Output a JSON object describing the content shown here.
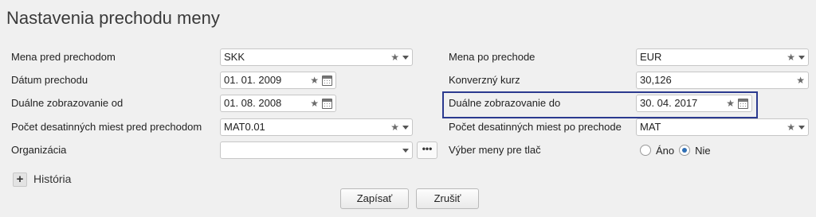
{
  "page": {
    "title": "Nastavenia prechodu meny"
  },
  "left": {
    "currency_before": {
      "label": "Mena pred prechodom",
      "value": "SKK"
    },
    "transition_date": {
      "label": "Dátum prechodu",
      "value": "01. 01. 2009"
    },
    "dual_display_from": {
      "label": "Duálne zobrazovanie od",
      "value": "01. 08. 2008"
    },
    "decimals_before": {
      "label": "Počet desatinných miest pred prechodom",
      "value": "MAT0.01"
    },
    "organization": {
      "label": "Organizácia",
      "value": "",
      "more_button": "•••"
    }
  },
  "right": {
    "currency_after": {
      "label": "Mena po prechode",
      "value": "EUR"
    },
    "conversion_rate": {
      "label": "Konverzný kurz",
      "value": "30,126"
    },
    "dual_display_to": {
      "label": "Duálne zobrazovanie do",
      "value": "30. 04. 2017"
    },
    "decimals_after": {
      "label": "Počet desatinných miest po prechode",
      "value": "MAT"
    },
    "print_currency": {
      "label": "Výber meny pre tlač",
      "options": [
        "Áno",
        "Nie"
      ],
      "selected": "Nie"
    }
  },
  "history": {
    "toggle": "+",
    "label": "História"
  },
  "actions": {
    "save": "Zapísať",
    "cancel": "Zrušiť"
  },
  "icons": {
    "star": "★",
    "favorite_icon": "star-icon",
    "dropdown_icon": "chevron-down-icon",
    "calendar_icon": "calendar-icon"
  },
  "colors": {
    "highlight_border": "#2b3a8f",
    "radio_selected": "#2f6fb5"
  }
}
